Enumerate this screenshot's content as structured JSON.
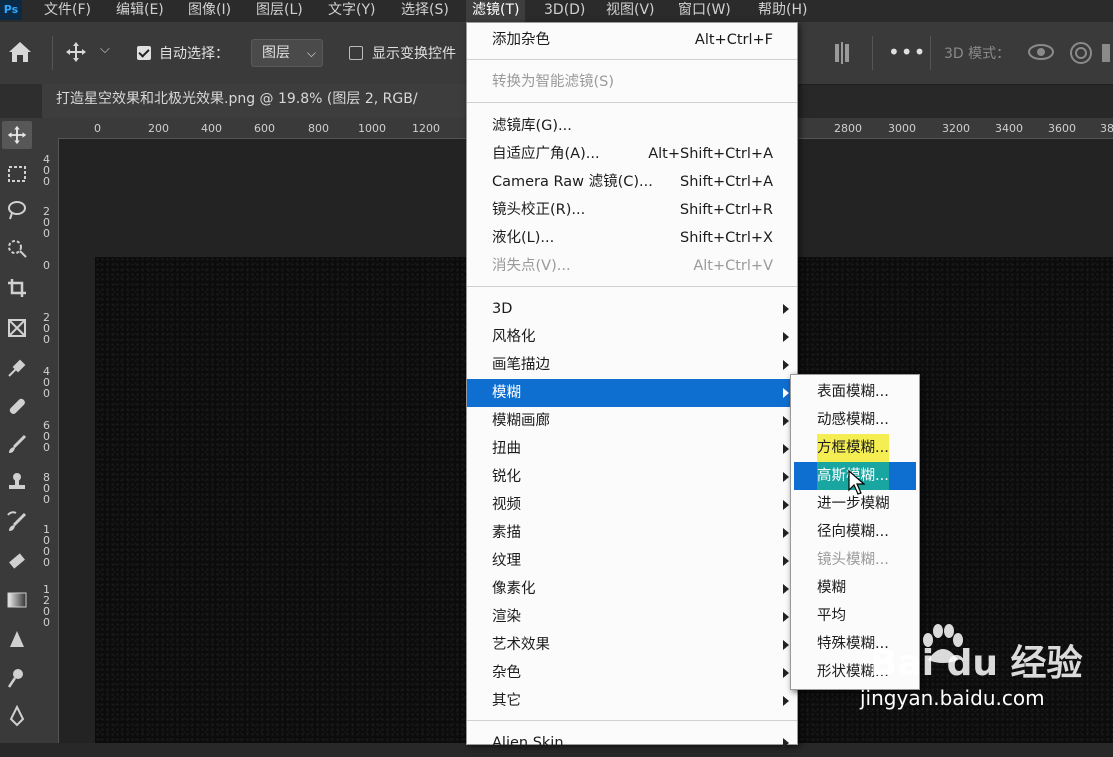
{
  "menubar": {
    "logo": "Ps",
    "items": [
      {
        "label": "文件(F)"
      },
      {
        "label": "编辑(E)"
      },
      {
        "label": "图像(I)"
      },
      {
        "label": "图层(L)"
      },
      {
        "label": "文字(Y)"
      },
      {
        "label": "选择(S)"
      },
      {
        "label": "滤镜(T)"
      },
      {
        "label": "3D(D)"
      },
      {
        "label": "视图(V)"
      },
      {
        "label": "窗口(W)"
      },
      {
        "label": "帮助(H)"
      }
    ]
  },
  "options": {
    "auto_select_label": "自动选择：",
    "auto_select_checked": true,
    "layer_select_value": "图层",
    "show_transform_label": "显示变换控件",
    "show_transform_checked": false,
    "mode_3d_label": "3D 模式："
  },
  "tab": {
    "title": "打造星空效果和北极光效果.png @ 19.8% (图层 2, RGB/"
  },
  "rulers": {
    "horizontal": [
      "0",
      "200",
      "400",
      "600",
      "800",
      "1000",
      "1200",
      "2800",
      "3000",
      "3200",
      "3400",
      "3600",
      "38"
    ],
    "vertical": [
      "4\n0\n0",
      "2\n0\n0",
      "0",
      "2\n0\n0",
      "4\n0\n0",
      "6\n0\n0",
      "8\n0\n0",
      "1\n0\n0\n0",
      "1\n2\n0\n0"
    ]
  },
  "filter_menu": {
    "items": [
      {
        "label": "添加杂色",
        "shortcut": "Alt+Ctrl+F"
      },
      {
        "label": "转换为智能滤镜(S)",
        "disabled": true
      },
      {
        "label": "滤镜库(G)..."
      },
      {
        "label": "自适应广角(A)...",
        "shortcut": "Alt+Shift+Ctrl+A"
      },
      {
        "label": "Camera Raw 滤镜(C)...",
        "shortcut": "Shift+Ctrl+A"
      },
      {
        "label": "镜头校正(R)...",
        "shortcut": "Shift+Ctrl+R"
      },
      {
        "label": "液化(L)...",
        "shortcut": "Shift+Ctrl+X"
      },
      {
        "label": "消失点(V)...",
        "shortcut": "Alt+Ctrl+V",
        "disabled": true
      },
      {
        "label": "3D",
        "submenu": true
      },
      {
        "label": "风格化",
        "submenu": true
      },
      {
        "label": "画笔描边",
        "submenu": true
      },
      {
        "label": "模糊",
        "submenu": true,
        "highlighted": true
      },
      {
        "label": "模糊画廊",
        "submenu": true
      },
      {
        "label": "扭曲",
        "submenu": true
      },
      {
        "label": "锐化",
        "submenu": true
      },
      {
        "label": "视频",
        "submenu": true
      },
      {
        "label": "素描",
        "submenu": true
      },
      {
        "label": "纹理",
        "submenu": true
      },
      {
        "label": "像素化",
        "submenu": true
      },
      {
        "label": "渲染",
        "submenu": true
      },
      {
        "label": "艺术效果",
        "submenu": true
      },
      {
        "label": "杂色",
        "submenu": true
      },
      {
        "label": "其它",
        "submenu": true
      },
      {
        "label": "Alien Skin",
        "submenu": true
      }
    ]
  },
  "blur_submenu": {
    "items": [
      {
        "label": "表面模糊..."
      },
      {
        "label": "动感模糊..."
      },
      {
        "label": "方框模糊...",
        "marked": true
      },
      {
        "label": "高斯模糊...",
        "highlighted": true
      },
      {
        "label": "进一步模糊"
      },
      {
        "label": "径向模糊..."
      },
      {
        "label": "镜头模糊...",
        "disabled": true
      },
      {
        "label": "模糊"
      },
      {
        "label": "平均"
      },
      {
        "label": "特殊模糊..."
      },
      {
        "label": "形状模糊..."
      }
    ]
  },
  "watermark": {
    "logo": "Bai du 经验",
    "url": "jingyan.baidu.com"
  },
  "colors": {
    "highlight": "#0f6fd0",
    "menu_bg": "#fbfbfb",
    "app_bg": "#282828"
  }
}
